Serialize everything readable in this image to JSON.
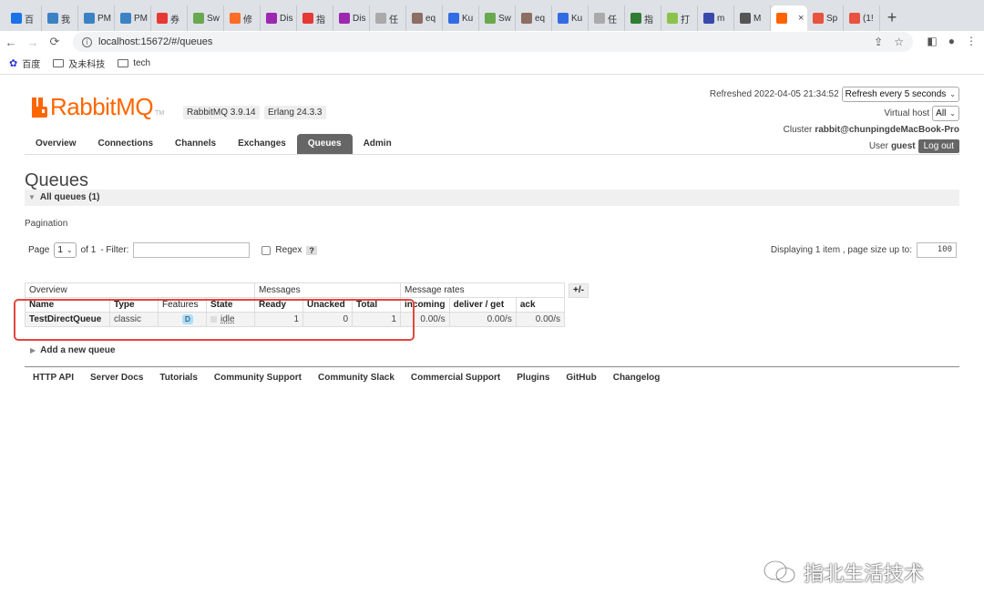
{
  "browser": {
    "tabs": [
      {
        "title": "百",
        "color": "#1a73e8"
      },
      {
        "title": "我",
        "color": "#3b82c4"
      },
      {
        "title": "PM",
        "color": "#3b82c4"
      },
      {
        "title": "PM",
        "color": "#3b82c4"
      },
      {
        "title": "券",
        "color": "#e53935"
      },
      {
        "title": "Sw",
        "color": "#6aa84f"
      },
      {
        "title": "修",
        "color": "#fc6d26"
      },
      {
        "title": "Dis",
        "color": "#9c27b0"
      },
      {
        "title": "指",
        "color": "#e53935"
      },
      {
        "title": "Dis",
        "color": "#9c27b0"
      },
      {
        "title": "任",
        "color": "#aaaaaa"
      },
      {
        "title": "eq",
        "color": "#8d6e63"
      },
      {
        "title": "Ku",
        "color": "#326ce5"
      },
      {
        "title": "Sw",
        "color": "#6aa84f"
      },
      {
        "title": "eq",
        "color": "#8d6e63"
      },
      {
        "title": "Ku",
        "color": "#326ce5"
      },
      {
        "title": "任",
        "color": "#aaaaaa"
      },
      {
        "title": "指",
        "color": "#2e7d32"
      },
      {
        "title": "打",
        "color": "#8bc34a"
      },
      {
        "title": "m",
        "color": "#3949ab"
      },
      {
        "title": "M",
        "color": "#555555"
      },
      {
        "title": "",
        "color": "#ff6600",
        "active": true
      },
      {
        "title": "Sp",
        "color": "#e8523f"
      },
      {
        "title": "(1!",
        "color": "#e8523f"
      }
    ],
    "active_tab_close": "×",
    "new_tab": "+",
    "url": "localhost:15672/#/queues",
    "bookmarks": [
      "百度",
      "及未科技",
      "tech"
    ]
  },
  "rabbitmq": {
    "logo_text": "RabbitMQ",
    "logo_tm": "TM",
    "version": "RabbitMQ 3.9.14",
    "erlang": "Erlang 24.3.3",
    "refreshed_label": "Refreshed 2022-04-05 21:34:52",
    "refresh_select": "Refresh every 5 seconds",
    "vhost_label": "Virtual host",
    "vhost_value": "All",
    "cluster_label": "Cluster",
    "cluster_name": "rabbit@chunpingdeMacBook-Pro",
    "user_label": "User",
    "user_name": "guest",
    "logout": "Log out",
    "nav": [
      "Overview",
      "Connections",
      "Channels",
      "Exchanges",
      "Queues",
      "Admin"
    ],
    "active_nav": "Queues"
  },
  "queues_page": {
    "title": "Queues",
    "section": "All queues (1)",
    "pagination_label": "Pagination",
    "page_label": "Page",
    "page_value": "1",
    "of_pages": "of 1",
    "filter_label": "- Filter:",
    "regex_label": "Regex",
    "regex_help": "?",
    "displaying": "Displaying 1 item , page size up to:",
    "page_size": "100",
    "groups": [
      "Overview",
      "Messages",
      "Message rates"
    ],
    "plus_minus": "+/-",
    "columns": [
      "Name",
      "Type",
      "Features",
      "State",
      "Ready",
      "Unacked",
      "Total",
      "incoming",
      "deliver / get",
      "ack"
    ],
    "rows": [
      {
        "name": "TestDirectQueue",
        "type": "classic",
        "features": "D",
        "state": "idle",
        "ready": "1",
        "unacked": "0",
        "total": "1",
        "incoming": "0.00/s",
        "deliver_get": "0.00/s",
        "ack": "0.00/s"
      }
    ],
    "add_queue": "Add a new queue"
  },
  "footer": [
    "HTTP API",
    "Server Docs",
    "Tutorials",
    "Community Support",
    "Community Slack",
    "Commercial Support",
    "Plugins",
    "GitHub",
    "Changelog"
  ],
  "watermark": "指北生活技术"
}
